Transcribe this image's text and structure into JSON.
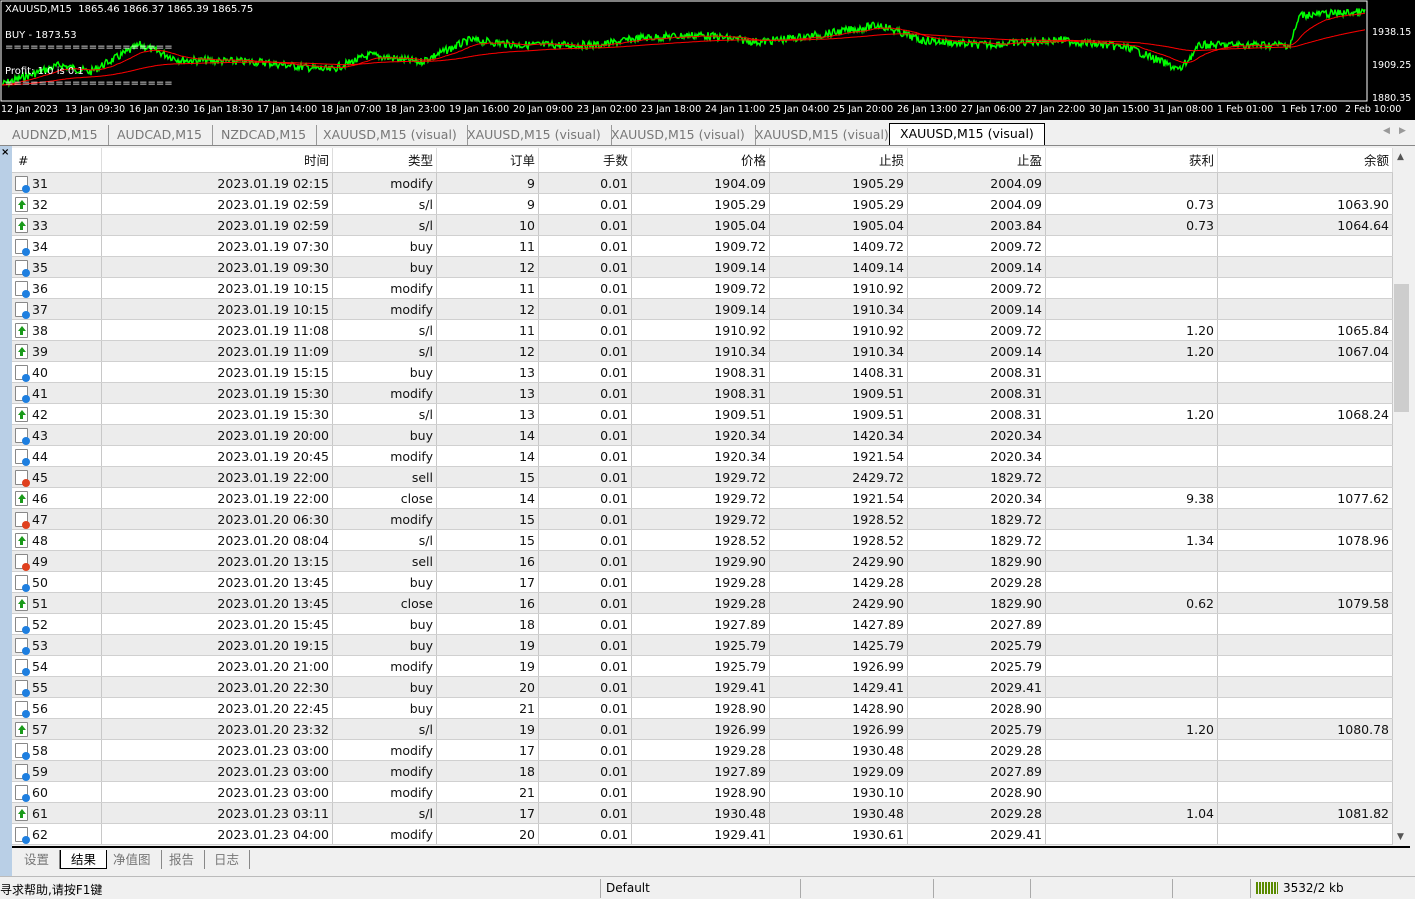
{
  "chart": {
    "symbol_line": "XAUUSD,M15  1865.46 1866.37 1865.39 1865.75",
    "buy_label": "BUY - 1873.53",
    "separator": "====================",
    "profit_label": "Profit: 1.0 is 0.1",
    "time_labels": [
      "12 Jan 2023",
      "13 Jan 09:30",
      "16 Jan 02:30",
      "16 Jan 18:30",
      "17 Jan 14:00",
      "18 Jan 07:00",
      "18 Jan 23:00",
      "19 Jan 16:00",
      "20 Jan 09:00",
      "23 Jan 02:00",
      "23 Jan 18:00",
      "24 Jan 11:00",
      "25 Jan 04:00",
      "25 Jan 20:00",
      "26 Jan 13:00",
      "27 Jan 06:00",
      "27 Jan 22:00",
      "30 Jan 15:00",
      "31 Jan 08:00",
      "1 Feb 01:00",
      "1 Feb 17:00",
      "2 Feb 10:00"
    ],
    "price_labels": [
      "1938.15",
      "1909.25",
      "1880.35"
    ],
    "colors": {
      "price": "#00ff00",
      "ma": "#ff0000"
    }
  },
  "tabs": [
    "AUDNZD,M15",
    "AUDCAD,M15",
    "NZDCAD,M15",
    "XAUUSD,M15 (visual)",
    "XAUUSD,M15 (visual)",
    "XAUUSD,M15 (visual)",
    "XAUUSD,M15 (visual)",
    "XAUUSD,M15 (visual)"
  ],
  "active_tab": 7,
  "columns": [
    "#",
    "时间",
    "类型",
    "订单",
    "手数",
    "价格",
    "止损",
    "止盈",
    "获利",
    "余额"
  ],
  "rows": [
    [
      "31",
      "2023.01.19 02:15",
      "modify",
      "9",
      "0.01",
      "1904.09",
      "1905.29",
      "2004.09",
      "",
      "",
      "buy"
    ],
    [
      "32",
      "2023.01.19 02:59",
      "s/l",
      "9",
      "0.01",
      "1905.29",
      "1905.29",
      "2004.09",
      "0.73",
      "1063.90",
      "close"
    ],
    [
      "33",
      "2023.01.19 02:59",
      "s/l",
      "10",
      "0.01",
      "1905.04",
      "1905.04",
      "2003.84",
      "0.73",
      "1064.64",
      "close"
    ],
    [
      "34",
      "2023.01.19 07:30",
      "buy",
      "11",
      "0.01",
      "1909.72",
      "1409.72",
      "2009.72",
      "",
      "",
      "buy"
    ],
    [
      "35",
      "2023.01.19 09:30",
      "buy",
      "12",
      "0.01",
      "1909.14",
      "1409.14",
      "2009.14",
      "",
      "",
      "buy"
    ],
    [
      "36",
      "2023.01.19 10:15",
      "modify",
      "11",
      "0.01",
      "1909.72",
      "1910.92",
      "2009.72",
      "",
      "",
      "buy"
    ],
    [
      "37",
      "2023.01.19 10:15",
      "modify",
      "12",
      "0.01",
      "1909.14",
      "1910.34",
      "2009.14",
      "",
      "",
      "buy"
    ],
    [
      "38",
      "2023.01.19 11:08",
      "s/l",
      "11",
      "0.01",
      "1910.92",
      "1910.92",
      "2009.72",
      "1.20",
      "1065.84",
      "close"
    ],
    [
      "39",
      "2023.01.19 11:09",
      "s/l",
      "12",
      "0.01",
      "1910.34",
      "1910.34",
      "2009.14",
      "1.20",
      "1067.04",
      "close"
    ],
    [
      "40",
      "2023.01.19 15:15",
      "buy",
      "13",
      "0.01",
      "1908.31",
      "1408.31",
      "2008.31",
      "",
      "",
      "buy"
    ],
    [
      "41",
      "2023.01.19 15:30",
      "modify",
      "13",
      "0.01",
      "1908.31",
      "1909.51",
      "2008.31",
      "",
      "",
      "buy"
    ],
    [
      "42",
      "2023.01.19 15:30",
      "s/l",
      "13",
      "0.01",
      "1909.51",
      "1909.51",
      "2008.31",
      "1.20",
      "1068.24",
      "close"
    ],
    [
      "43",
      "2023.01.19 20:00",
      "buy",
      "14",
      "0.01",
      "1920.34",
      "1420.34",
      "2020.34",
      "",
      "",
      "buy"
    ],
    [
      "44",
      "2023.01.19 20:45",
      "modify",
      "14",
      "0.01",
      "1920.34",
      "1921.54",
      "2020.34",
      "",
      "",
      "buy"
    ],
    [
      "45",
      "2023.01.19 22:00",
      "sell",
      "15",
      "0.01",
      "1929.72",
      "2429.72",
      "1829.72",
      "",
      "",
      "sell"
    ],
    [
      "46",
      "2023.01.19 22:00",
      "close",
      "14",
      "0.01",
      "1929.72",
      "1921.54",
      "2020.34",
      "9.38",
      "1077.62",
      "close"
    ],
    [
      "47",
      "2023.01.20 06:30",
      "modify",
      "15",
      "0.01",
      "1929.72",
      "1928.52",
      "1829.72",
      "",
      "",
      "sell"
    ],
    [
      "48",
      "2023.01.20 08:04",
      "s/l",
      "15",
      "0.01",
      "1928.52",
      "1928.52",
      "1829.72",
      "1.34",
      "1078.96",
      "close"
    ],
    [
      "49",
      "2023.01.20 13:15",
      "sell",
      "16",
      "0.01",
      "1929.90",
      "2429.90",
      "1829.90",
      "",
      "",
      "sell"
    ],
    [
      "50",
      "2023.01.20 13:45",
      "buy",
      "17",
      "0.01",
      "1929.28",
      "1429.28",
      "2029.28",
      "",
      "",
      "buy"
    ],
    [
      "51",
      "2023.01.20 13:45",
      "close",
      "16",
      "0.01",
      "1929.28",
      "2429.90",
      "1829.90",
      "0.62",
      "1079.58",
      "close"
    ],
    [
      "52",
      "2023.01.20 15:45",
      "buy",
      "18",
      "0.01",
      "1927.89",
      "1427.89",
      "2027.89",
      "",
      "",
      "buy"
    ],
    [
      "53",
      "2023.01.20 19:15",
      "buy",
      "19",
      "0.01",
      "1925.79",
      "1425.79",
      "2025.79",
      "",
      "",
      "buy"
    ],
    [
      "54",
      "2023.01.20 21:00",
      "modify",
      "19",
      "0.01",
      "1925.79",
      "1926.99",
      "2025.79",
      "",
      "",
      "buy"
    ],
    [
      "55",
      "2023.01.20 22:30",
      "buy",
      "20",
      "0.01",
      "1929.41",
      "1429.41",
      "2029.41",
      "",
      "",
      "buy"
    ],
    [
      "56",
      "2023.01.20 22:45",
      "buy",
      "21",
      "0.01",
      "1928.90",
      "1428.90",
      "2028.90",
      "",
      "",
      "buy"
    ],
    [
      "57",
      "2023.01.20 23:32",
      "s/l",
      "19",
      "0.01",
      "1926.99",
      "1926.99",
      "2025.79",
      "1.20",
      "1080.78",
      "close"
    ],
    [
      "58",
      "2023.01.23 03:00",
      "modify",
      "17",
      "0.01",
      "1929.28",
      "1930.48",
      "2029.28",
      "",
      "",
      "buy"
    ],
    [
      "59",
      "2023.01.23 03:00",
      "modify",
      "18",
      "0.01",
      "1927.89",
      "1929.09",
      "2027.89",
      "",
      "",
      "buy"
    ],
    [
      "60",
      "2023.01.23 03:00",
      "modify",
      "21",
      "0.01",
      "1928.90",
      "1930.10",
      "2028.90",
      "",
      "",
      "buy"
    ],
    [
      "61",
      "2023.01.23 03:11",
      "s/l",
      "17",
      "0.01",
      "1930.48",
      "1930.48",
      "2029.28",
      "1.04",
      "1081.82",
      "close"
    ],
    [
      "62",
      "2023.01.23 04:00",
      "modify",
      "20",
      "0.01",
      "1929.41",
      "1930.61",
      "2029.41",
      "",
      "",
      "buy"
    ]
  ],
  "bottom_tabs": [
    "设置",
    "结果",
    "净值图",
    "报告",
    "日志"
  ],
  "active_bottom_tab": 1,
  "status": {
    "help": "寻求帮助,请按F1键",
    "profile": "Default",
    "traffic": "3532/2 kb"
  },
  "icon_colors": {
    "buy": "#1e7fe0",
    "sell": "#e0401e"
  }
}
